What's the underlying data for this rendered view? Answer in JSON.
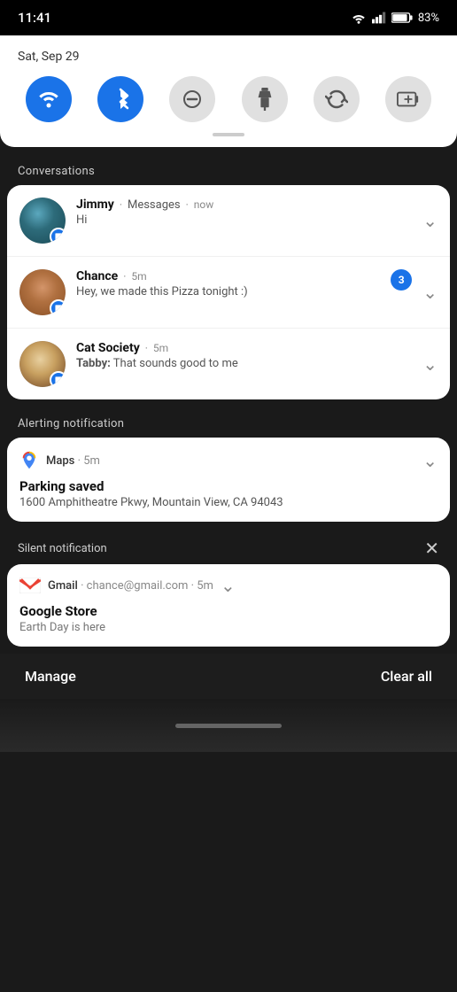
{
  "statusBar": {
    "time": "11:41",
    "battery": "83%",
    "batteryIcon": "🔋",
    "wifiIcon": "wifi",
    "signalIcon": "signal"
  },
  "quickSettings": {
    "date": "Sat, Sep 29",
    "toggles": [
      {
        "id": "wifi",
        "label": "WiFi",
        "active": true,
        "icon": "wifi"
      },
      {
        "id": "bluetooth",
        "label": "Bluetooth",
        "active": true,
        "icon": "bluetooth"
      },
      {
        "id": "dnd",
        "label": "Do Not Disturb",
        "active": false,
        "icon": "dnd"
      },
      {
        "id": "flashlight",
        "label": "Flashlight",
        "active": false,
        "icon": "flashlight"
      },
      {
        "id": "rotate",
        "label": "Auto-rotate",
        "active": false,
        "icon": "rotate"
      },
      {
        "id": "battery-saver",
        "label": "Battery Saver",
        "active": false,
        "icon": "battery"
      }
    ]
  },
  "sections": {
    "conversations": {
      "label": "Conversations",
      "notifications": [
        {
          "id": "jimmy",
          "name": "Jimmy",
          "app": "Messages",
          "time": "now",
          "body": "Hi",
          "unread": 0,
          "avatarType": "jimmy"
        },
        {
          "id": "chance",
          "name": "Chance",
          "app": "",
          "time": "5m",
          "body": "Hey, we made this Pizza tonight :)",
          "unread": 3,
          "avatarType": "chance"
        },
        {
          "id": "cat-society",
          "name": "Cat Society",
          "app": "",
          "time": "5m",
          "body": "Tabby: That sounds good to me",
          "unread": 0,
          "avatarType": "cat"
        }
      ]
    },
    "alerting": {
      "label": "Alerting notification",
      "notifications": [
        {
          "id": "maps",
          "app": "Maps",
          "time": "5m",
          "title": "Parking saved",
          "body": "1600 Amphitheatre Pkwy, Mountain View, CA 94043"
        }
      ]
    },
    "silent": {
      "label": "Silent notification",
      "notifications": [
        {
          "id": "gmail",
          "app": "Gmail",
          "sender": "chance@gmail.com",
          "time": "5m",
          "title": "Google Store",
          "body": "Earth Day is here"
        }
      ]
    }
  },
  "bottomBar": {
    "manage": "Manage",
    "clearAll": "Clear all"
  }
}
